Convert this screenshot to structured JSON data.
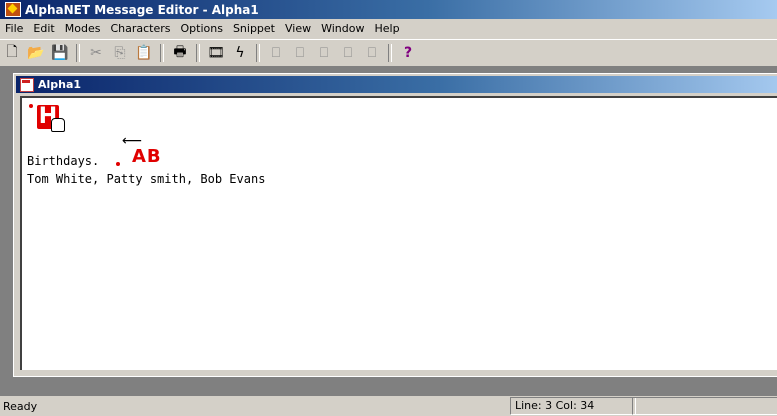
{
  "window": {
    "title": "AlphaNET Message Editor - Alpha1"
  },
  "menu": [
    "File",
    "Edit",
    "Modes",
    "Characters",
    "Options",
    "Snippet",
    "View",
    "Window",
    "Help"
  ],
  "toolbar": {
    "buttons": [
      {
        "name": "new-file-icon",
        "glyph": "🗋"
      },
      {
        "name": "open-folder-icon",
        "glyph": "📂"
      },
      {
        "name": "save-icon",
        "glyph": "💾"
      },
      {
        "name": "cut-icon",
        "glyph": "✂"
      },
      {
        "name": "copy-icon",
        "glyph": "⎘"
      },
      {
        "name": "paste-icon",
        "glyph": "📋"
      },
      {
        "name": "print-icon",
        "glyph": "🖶"
      },
      {
        "name": "film-icon",
        "glyph": "🎞"
      },
      {
        "name": "lightning-icon",
        "glyph": "ϟ"
      },
      {
        "name": "page-1-icon",
        "glyph": "⎕"
      },
      {
        "name": "page-2-icon",
        "glyph": "⎕"
      },
      {
        "name": "page-3-icon",
        "glyph": "⎕"
      },
      {
        "name": "page-4-icon",
        "glyph": "⎕"
      },
      {
        "name": "page-5-icon",
        "glyph": "⎕"
      },
      {
        "name": "help-icon",
        "glyph": "?"
      }
    ]
  },
  "document": {
    "title": "Alpha1",
    "tag_h": "H",
    "tag_ab": "AB",
    "line1": "Birthdays.",
    "line2": "Tom White, Patty smith, Bob Evans"
  },
  "status": {
    "ready": "Ready",
    "position": "Line: 3  Col: 34"
  },
  "colors": {
    "accent": "#0a246a",
    "tag_red": "#e00000",
    "chrome": "#d4d0c8"
  }
}
